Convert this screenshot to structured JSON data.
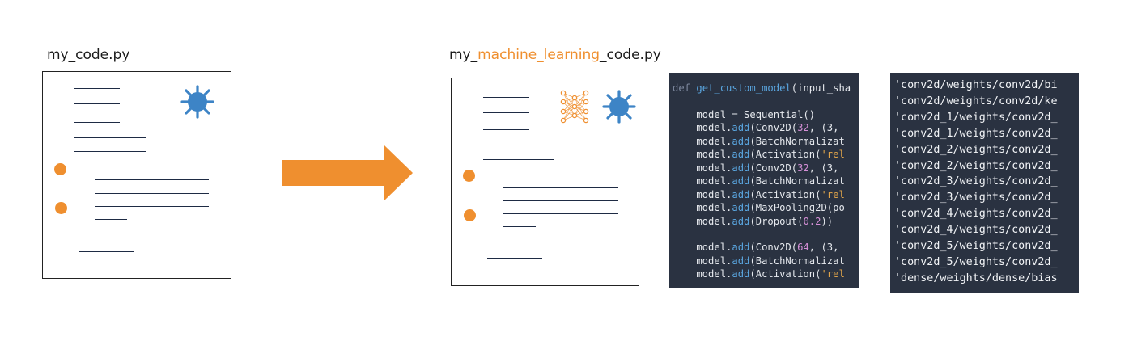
{
  "left": {
    "file_title": "my_code.py"
  },
  "right": {
    "file_title_prefix": "my_",
    "file_title_highlight": "machine_learning",
    "file_title_suffix": "_code.py"
  },
  "colors": {
    "accent": "#ef8f2f",
    "bug": "#3d84c6",
    "code_bg": "#2a3241",
    "line": "#1e2b44"
  },
  "icons": [
    "bug-icon",
    "neural-network-icon",
    "arrow-right-icon"
  ],
  "code_lines": [
    [
      {
        "t": "def ",
        "c": "kw"
      },
      {
        "t": "get_custom_model",
        "c": "fn"
      },
      {
        "t": "(input_sha",
        "c": ""
      }
    ],
    [
      {
        "t": "",
        "c": ""
      }
    ],
    [
      {
        "t": "    model = Sequential()",
        "c": ""
      }
    ],
    [
      {
        "t": "    model.",
        "c": ""
      },
      {
        "t": "add",
        "c": "fn"
      },
      {
        "t": "(Conv2D(",
        "c": ""
      },
      {
        "t": "32",
        "c": "num"
      },
      {
        "t": ", (3, ",
        "c": ""
      }
    ],
    [
      {
        "t": "    model.",
        "c": ""
      },
      {
        "t": "add",
        "c": "fn"
      },
      {
        "t": "(BatchNormalizat",
        "c": ""
      }
    ],
    [
      {
        "t": "    model.",
        "c": ""
      },
      {
        "t": "add",
        "c": "fn"
      },
      {
        "t": "(Activation(",
        "c": ""
      },
      {
        "t": "'rel",
        "c": "str"
      }
    ],
    [
      {
        "t": "    model.",
        "c": ""
      },
      {
        "t": "add",
        "c": "fn"
      },
      {
        "t": "(Conv2D(",
        "c": ""
      },
      {
        "t": "32",
        "c": "num"
      },
      {
        "t": ", (3, ",
        "c": ""
      }
    ],
    [
      {
        "t": "    model.",
        "c": ""
      },
      {
        "t": "add",
        "c": "fn"
      },
      {
        "t": "(BatchNormalizat",
        "c": ""
      }
    ],
    [
      {
        "t": "    model.",
        "c": ""
      },
      {
        "t": "add",
        "c": "fn"
      },
      {
        "t": "(Activation(",
        "c": ""
      },
      {
        "t": "'rel",
        "c": "str"
      }
    ],
    [
      {
        "t": "    model.",
        "c": ""
      },
      {
        "t": "add",
        "c": "fn"
      },
      {
        "t": "(MaxPooling2D(po",
        "c": ""
      }
    ],
    [
      {
        "t": "    model.",
        "c": ""
      },
      {
        "t": "add",
        "c": "fn"
      },
      {
        "t": "(Dropout(",
        "c": ""
      },
      {
        "t": "0.2",
        "c": "num"
      },
      {
        "t": "))",
        "c": ""
      }
    ],
    [
      {
        "t": "",
        "c": ""
      }
    ],
    [
      {
        "t": "    model.",
        "c": ""
      },
      {
        "t": "add",
        "c": "fn"
      },
      {
        "t": "(Conv2D(",
        "c": ""
      },
      {
        "t": "64",
        "c": "num"
      },
      {
        "t": ", (3, ",
        "c": ""
      }
    ],
    [
      {
        "t": "    model.",
        "c": ""
      },
      {
        "t": "add",
        "c": "fn"
      },
      {
        "t": "(BatchNormalizat",
        "c": ""
      }
    ],
    [
      {
        "t": "    model.",
        "c": ""
      },
      {
        "t": "add",
        "c": "fn"
      },
      {
        "t": "(Activation(",
        "c": ""
      },
      {
        "t": "'rel",
        "c": "str"
      }
    ]
  ],
  "weight_lines": [
    "'conv2d/weights/conv2d/bi",
    "'conv2d/weights/conv2d/ke",
    "'conv2d_1/weights/conv2d_",
    "'conv2d_1/weights/conv2d_",
    "'conv2d_2/weights/conv2d_",
    "'conv2d_2/weights/conv2d_",
    "'conv2d_3/weights/conv2d_",
    "'conv2d_3/weights/conv2d_",
    "'conv2d_4/weights/conv2d_",
    "'conv2d_4/weights/conv2d_",
    "'conv2d_5/weights/conv2d_",
    "'conv2d_5/weights/conv2d_",
    "'dense/weights/dense/bias"
  ]
}
